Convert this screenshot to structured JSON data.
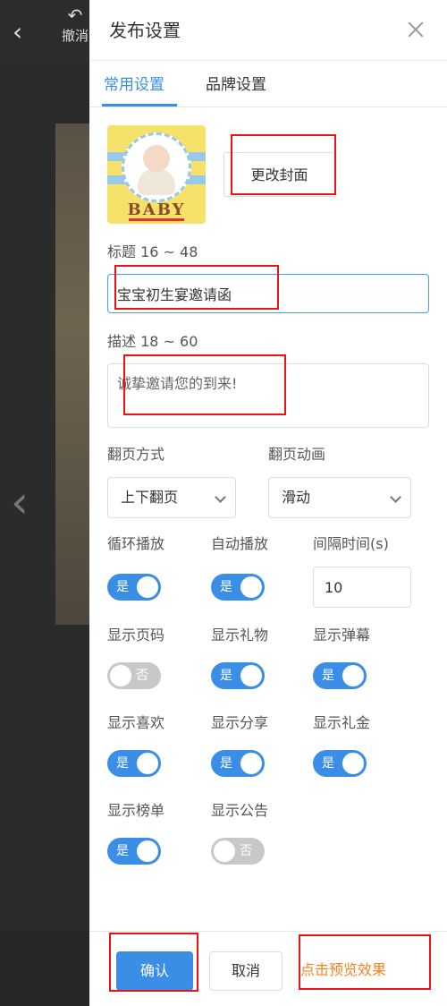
{
  "background": {
    "back_icon": "chevron-left-icon",
    "undo_icon": "undo-arrow-icon",
    "undo_label": "撤消",
    "prev_page_icon": "chevron-left-icon"
  },
  "panel": {
    "title": "发布设置",
    "close_icon": "close-icon"
  },
  "tabs": [
    {
      "label": "常用设置",
      "active": true
    },
    {
      "label": "品牌设置",
      "active": false
    }
  ],
  "cover": {
    "image_text": "BABY",
    "change_button": "更改封面"
  },
  "title_field": {
    "label": "标题 16 ~ 48",
    "value": "宝宝初生宴邀请函"
  },
  "description_field": {
    "label": "描述 18 ~ 60",
    "value": "诚挚邀请您的到来!"
  },
  "page_turn": {
    "mode_label": "翻页方式",
    "mode_value": "上下翻页",
    "animation_label": "翻页动画",
    "animation_value": "滑动"
  },
  "toggles": {
    "on_text": "是",
    "off_text": "否",
    "loop": {
      "label": "循环播放",
      "on": true
    },
    "autoplay": {
      "label": "自动播放",
      "on": true
    },
    "interval": {
      "label": "间隔时间(s)",
      "value": "10"
    },
    "page_number": {
      "label": "显示页码",
      "on": false
    },
    "gift": {
      "label": "显示礼物",
      "on": true
    },
    "danmaku": {
      "label": "显示弹幕",
      "on": true
    },
    "like": {
      "label": "显示喜欢",
      "on": true
    },
    "share": {
      "label": "显示分享",
      "on": true
    },
    "cash_gift": {
      "label": "显示礼金",
      "on": true
    },
    "ranking": {
      "label": "显示榜单",
      "on": true
    },
    "notice": {
      "label": "显示公告",
      "on": false
    }
  },
  "footer": {
    "confirm": "确认",
    "cancel": "取消",
    "preview": "点击预览效果"
  },
  "colors": {
    "accent": "#3a8ee6",
    "annotation": "#ee1111",
    "preview": "#f58220"
  }
}
